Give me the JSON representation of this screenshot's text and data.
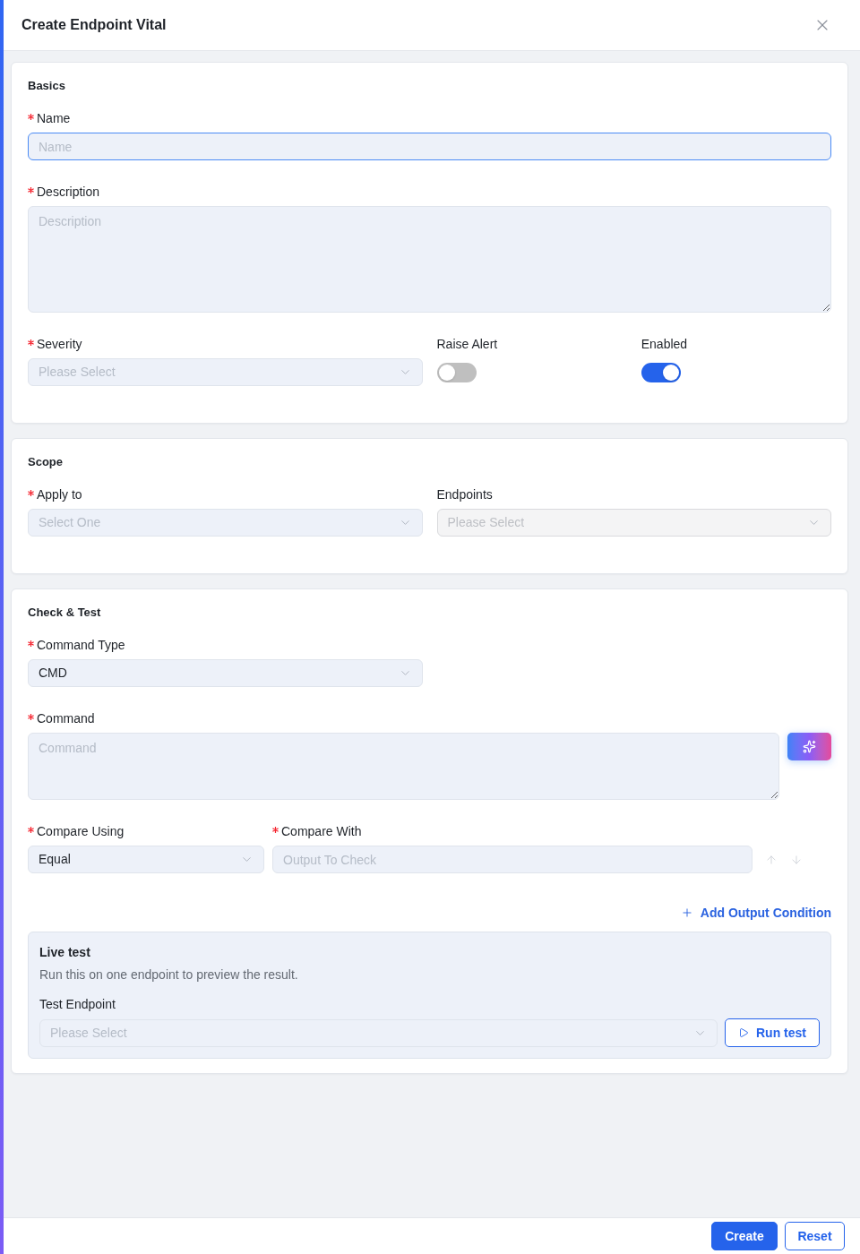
{
  "dialog": {
    "title": "Create Endpoint Vital"
  },
  "basics": {
    "title": "Basics",
    "name": {
      "label": "Name",
      "required": true,
      "placeholder": "Name",
      "focused": true
    },
    "description": {
      "label": "Description",
      "required": true,
      "placeholder": "Description"
    },
    "severity": {
      "label": "Severity",
      "required": true,
      "placeholder": "Please Select"
    },
    "raise_alert": {
      "label": "Raise Alert",
      "required": false,
      "on": false
    },
    "enabled": {
      "label": "Enabled",
      "required": false,
      "on": true
    }
  },
  "scope": {
    "title": "Scope",
    "apply_to": {
      "label": "Apply to",
      "required": true,
      "placeholder": "Select One"
    },
    "endpoints": {
      "label": "Endpoints",
      "required": false,
      "placeholder": "Please Select",
      "disabled": true
    }
  },
  "check_test": {
    "title": "Check & Test",
    "command_type": {
      "label": "Command Type",
      "required": true,
      "value": "CMD"
    },
    "command": {
      "label": "Command",
      "required": true,
      "placeholder": "Command"
    },
    "compare_using": {
      "label": "Compare Using",
      "required": true,
      "value": "Equal"
    },
    "compare_with": {
      "label": "Compare With",
      "required": true,
      "placeholder": "Output To Check"
    },
    "order_buttons": [
      {
        "kind": "up",
        "disabled": true
      },
      {
        "kind": "down",
        "disabled": true
      }
    ],
    "add_condition": {
      "label": "Add Output Condition"
    },
    "live_test": {
      "title": "Live test",
      "description": "Run this on one endpoint to preview the result.",
      "endpoint": {
        "label": "Test Endpoint",
        "required": false,
        "placeholder": "Please Select"
      },
      "run_button": {
        "label": "Run test"
      }
    }
  },
  "footer": {
    "buttons": [
      {
        "label": "Create",
        "kind": "primary"
      },
      {
        "label": "Reset",
        "kind": "secondary"
      }
    ]
  }
}
